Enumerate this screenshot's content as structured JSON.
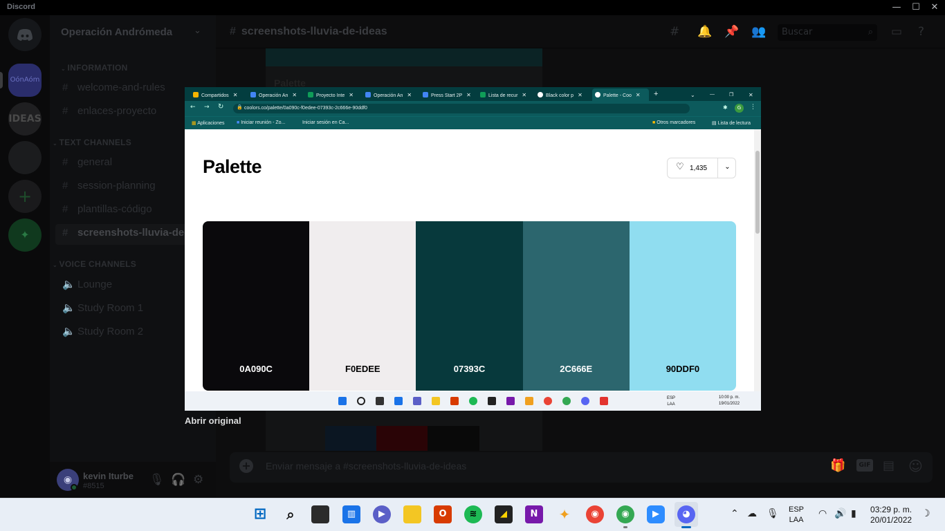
{
  "app": {
    "title": "Discord"
  },
  "window_controls": {
    "minimize": "—",
    "maximize": "☐",
    "close": "✕"
  },
  "servers": {
    "items": [
      {
        "label": "",
        "icon": "discord-logo"
      },
      {
        "label": "OónAóm"
      },
      {
        "label": "IDEAS"
      },
      {
        "label": ""
      },
      {
        "label": "+"
      },
      {
        "label": "✦",
        "icon": "explore"
      }
    ]
  },
  "sidebar": {
    "server_name": "Operación Andrómeda",
    "categories": {
      "information": "INFORMATION",
      "text": "TEXT CHANNELS",
      "voice": "VOICE CHANNELS"
    },
    "channels": {
      "welcome": "welcome-and-rules",
      "enlaces": "enlaces-proyecto",
      "general": "general",
      "session": "session-planning",
      "plantillas": "plantillas-código",
      "screenshots": "screenshots-lluvia-de-..."
    },
    "voice": {
      "lounge": "Lounge",
      "study1": "Study Room 1",
      "study2": "Study Room 2"
    }
  },
  "user": {
    "name": "kevin Iturbe",
    "tag": "#8515"
  },
  "header": {
    "channel": "screenshots-lluvia-de-ideas",
    "search_placeholder": "Buscar"
  },
  "composer": {
    "placeholder": "Enviar mensaje a #screenshots-lluvia-de-ideas"
  },
  "bg_image": {
    "title": "Palette"
  },
  "browser": {
    "tabs": [
      "Compartidos",
      "Operación An",
      "Proyecto Inte",
      "Operación An",
      "Press Start 2P",
      "Lista de recur",
      "Black color p",
      "Palette - Coo"
    ],
    "url": "coolors.co/palette/0a090c-f0edee-07393c-2c666e-90ddf0",
    "bookmarks": {
      "apps": "Aplicaciones",
      "zoom": "Iniciar reunión - Zo...",
      "canvas": "Iniciar sesión en Ca...",
      "others": "Otros marcadores",
      "reading": "Lista de lectura"
    },
    "new_tab": "+"
  },
  "palette": {
    "title": "Palette",
    "likes": "1,435",
    "colors": [
      {
        "hex": "0A090C",
        "color": "#0A090C",
        "text": "#ffffff"
      },
      {
        "hex": "F0EDEE",
        "color": "#F0EDEE",
        "text": "#000000"
      },
      {
        "hex": "07393C",
        "color": "#07393C",
        "text": "#ffffff"
      },
      {
        "hex": "2C666E",
        "color": "#2C666E",
        "text": "#ffffff"
      },
      {
        "hex": "90DDF0",
        "color": "#90DDF0",
        "text": "#000000"
      }
    ]
  },
  "inner_taskbar": {
    "lang1": "ESP",
    "lang2": "LAA",
    "time": "10:00 p. m.",
    "date": "19/01/2022"
  },
  "lightbox": {
    "open_original": "Abrir original"
  },
  "taskbar": {
    "lang1": "ESP",
    "lang2": "LAA",
    "time": "03:29 p. m.",
    "date": "20/01/2022"
  }
}
